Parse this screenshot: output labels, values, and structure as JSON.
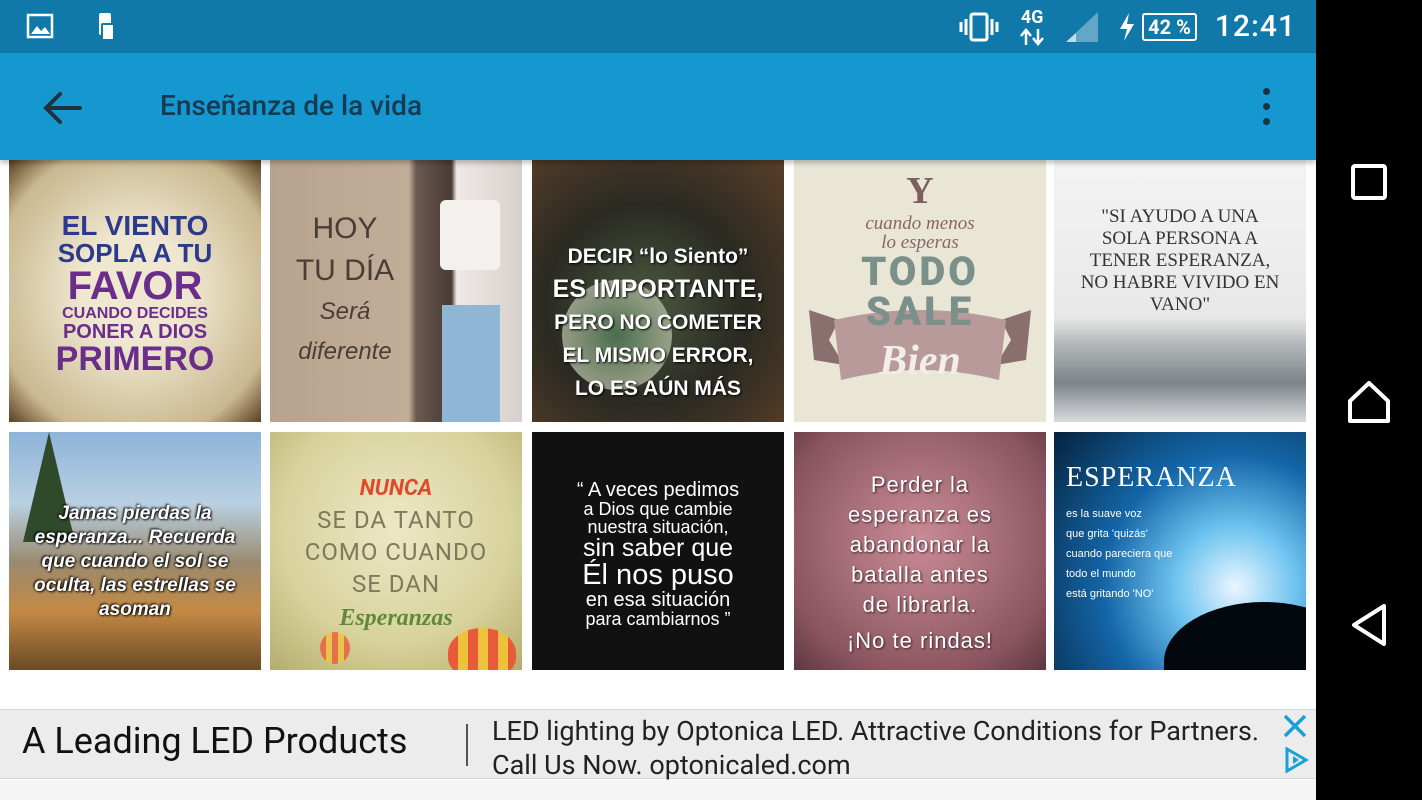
{
  "status_bar": {
    "time": "12:41",
    "network": "4G",
    "battery": "42 %",
    "icons": [
      "gallery-icon",
      "phone-download-icon",
      "vibrate-icon",
      "data-arrows-icon",
      "signal-icon",
      "charging-icon"
    ]
  },
  "app_bar": {
    "title": "Enseñanza de la vida",
    "back_icon": "arrow-left-icon",
    "menu_icon": "more-vert-icon"
  },
  "grid": {
    "images": [
      {
        "lines": [
          "EL VIENTO",
          "SOPLA A TU",
          "FAVOR",
          "CUANDO DECIDES",
          "PONER A DIOS",
          "PRIMERO"
        ]
      },
      {
        "lines": [
          "HOY",
          "TU DÍA",
          "Será diferente"
        ]
      },
      {
        "lines": [
          "DECIR “lo Siento”",
          "ES IMPORTANTE,",
          "PERO NO COMETER",
          "EL MISMO ERROR,",
          "LO ES AÚN MÁS"
        ]
      },
      {
        "lines": [
          "Y",
          "cuando menos",
          "lo esperas",
          "TODO",
          "SALE",
          "Bien"
        ]
      },
      {
        "lines": [
          "\"SI AYUDO A UNA",
          "SOLA PERSONA A",
          "TENER ESPERANZA,",
          "NO HABRE VIVIDO EN",
          "VANO\""
        ]
      },
      {
        "lines": [
          "Jamas pierdas la",
          "esperanza... Recuerda",
          "que cuando el sol se",
          "oculta, las estrellas se",
          "asoman"
        ]
      },
      {
        "lines": [
          "NUNCA",
          "SE DA TANTO",
          "COMO CUANDO",
          "SE DAN",
          "Esperanzas"
        ]
      },
      {
        "lines": [
          "“ A veces pedimos",
          "a Dios que cambie",
          "nuestra situación,",
          "sin saber que",
          "Él nos puso",
          "en esa situación",
          "para cambiarnos ”"
        ]
      },
      {
        "lines": [
          "Perder la",
          "esperanza es",
          "abandonar la",
          "batalla antes",
          "de librarla.",
          "¡No te rindas!"
        ]
      },
      {
        "lines": [
          "ESPERANZA",
          "es la suave voz",
          "que grita 'quizás'",
          "cuando pareciera que",
          "todo el mundo",
          "está gritando 'NO'"
        ]
      }
    ]
  },
  "ad": {
    "headline": "A Leading LED Products",
    "body": "LED lighting by Optonica LED. Attractive Conditions for Partners. Call Us Now. optonicaled.com",
    "close_icon": "close-icon",
    "adchoices_icon": "adchoices-icon"
  },
  "nav_bar": {
    "icons": [
      "recents-square-icon",
      "home-icon",
      "back-triangle-icon"
    ]
  },
  "colors": {
    "status_bar": "#1079a9",
    "app_bar": "#1597cf",
    "title_text": "#163a50",
    "nav_bar": "#000000",
    "ad_bg": "#ececec"
  }
}
